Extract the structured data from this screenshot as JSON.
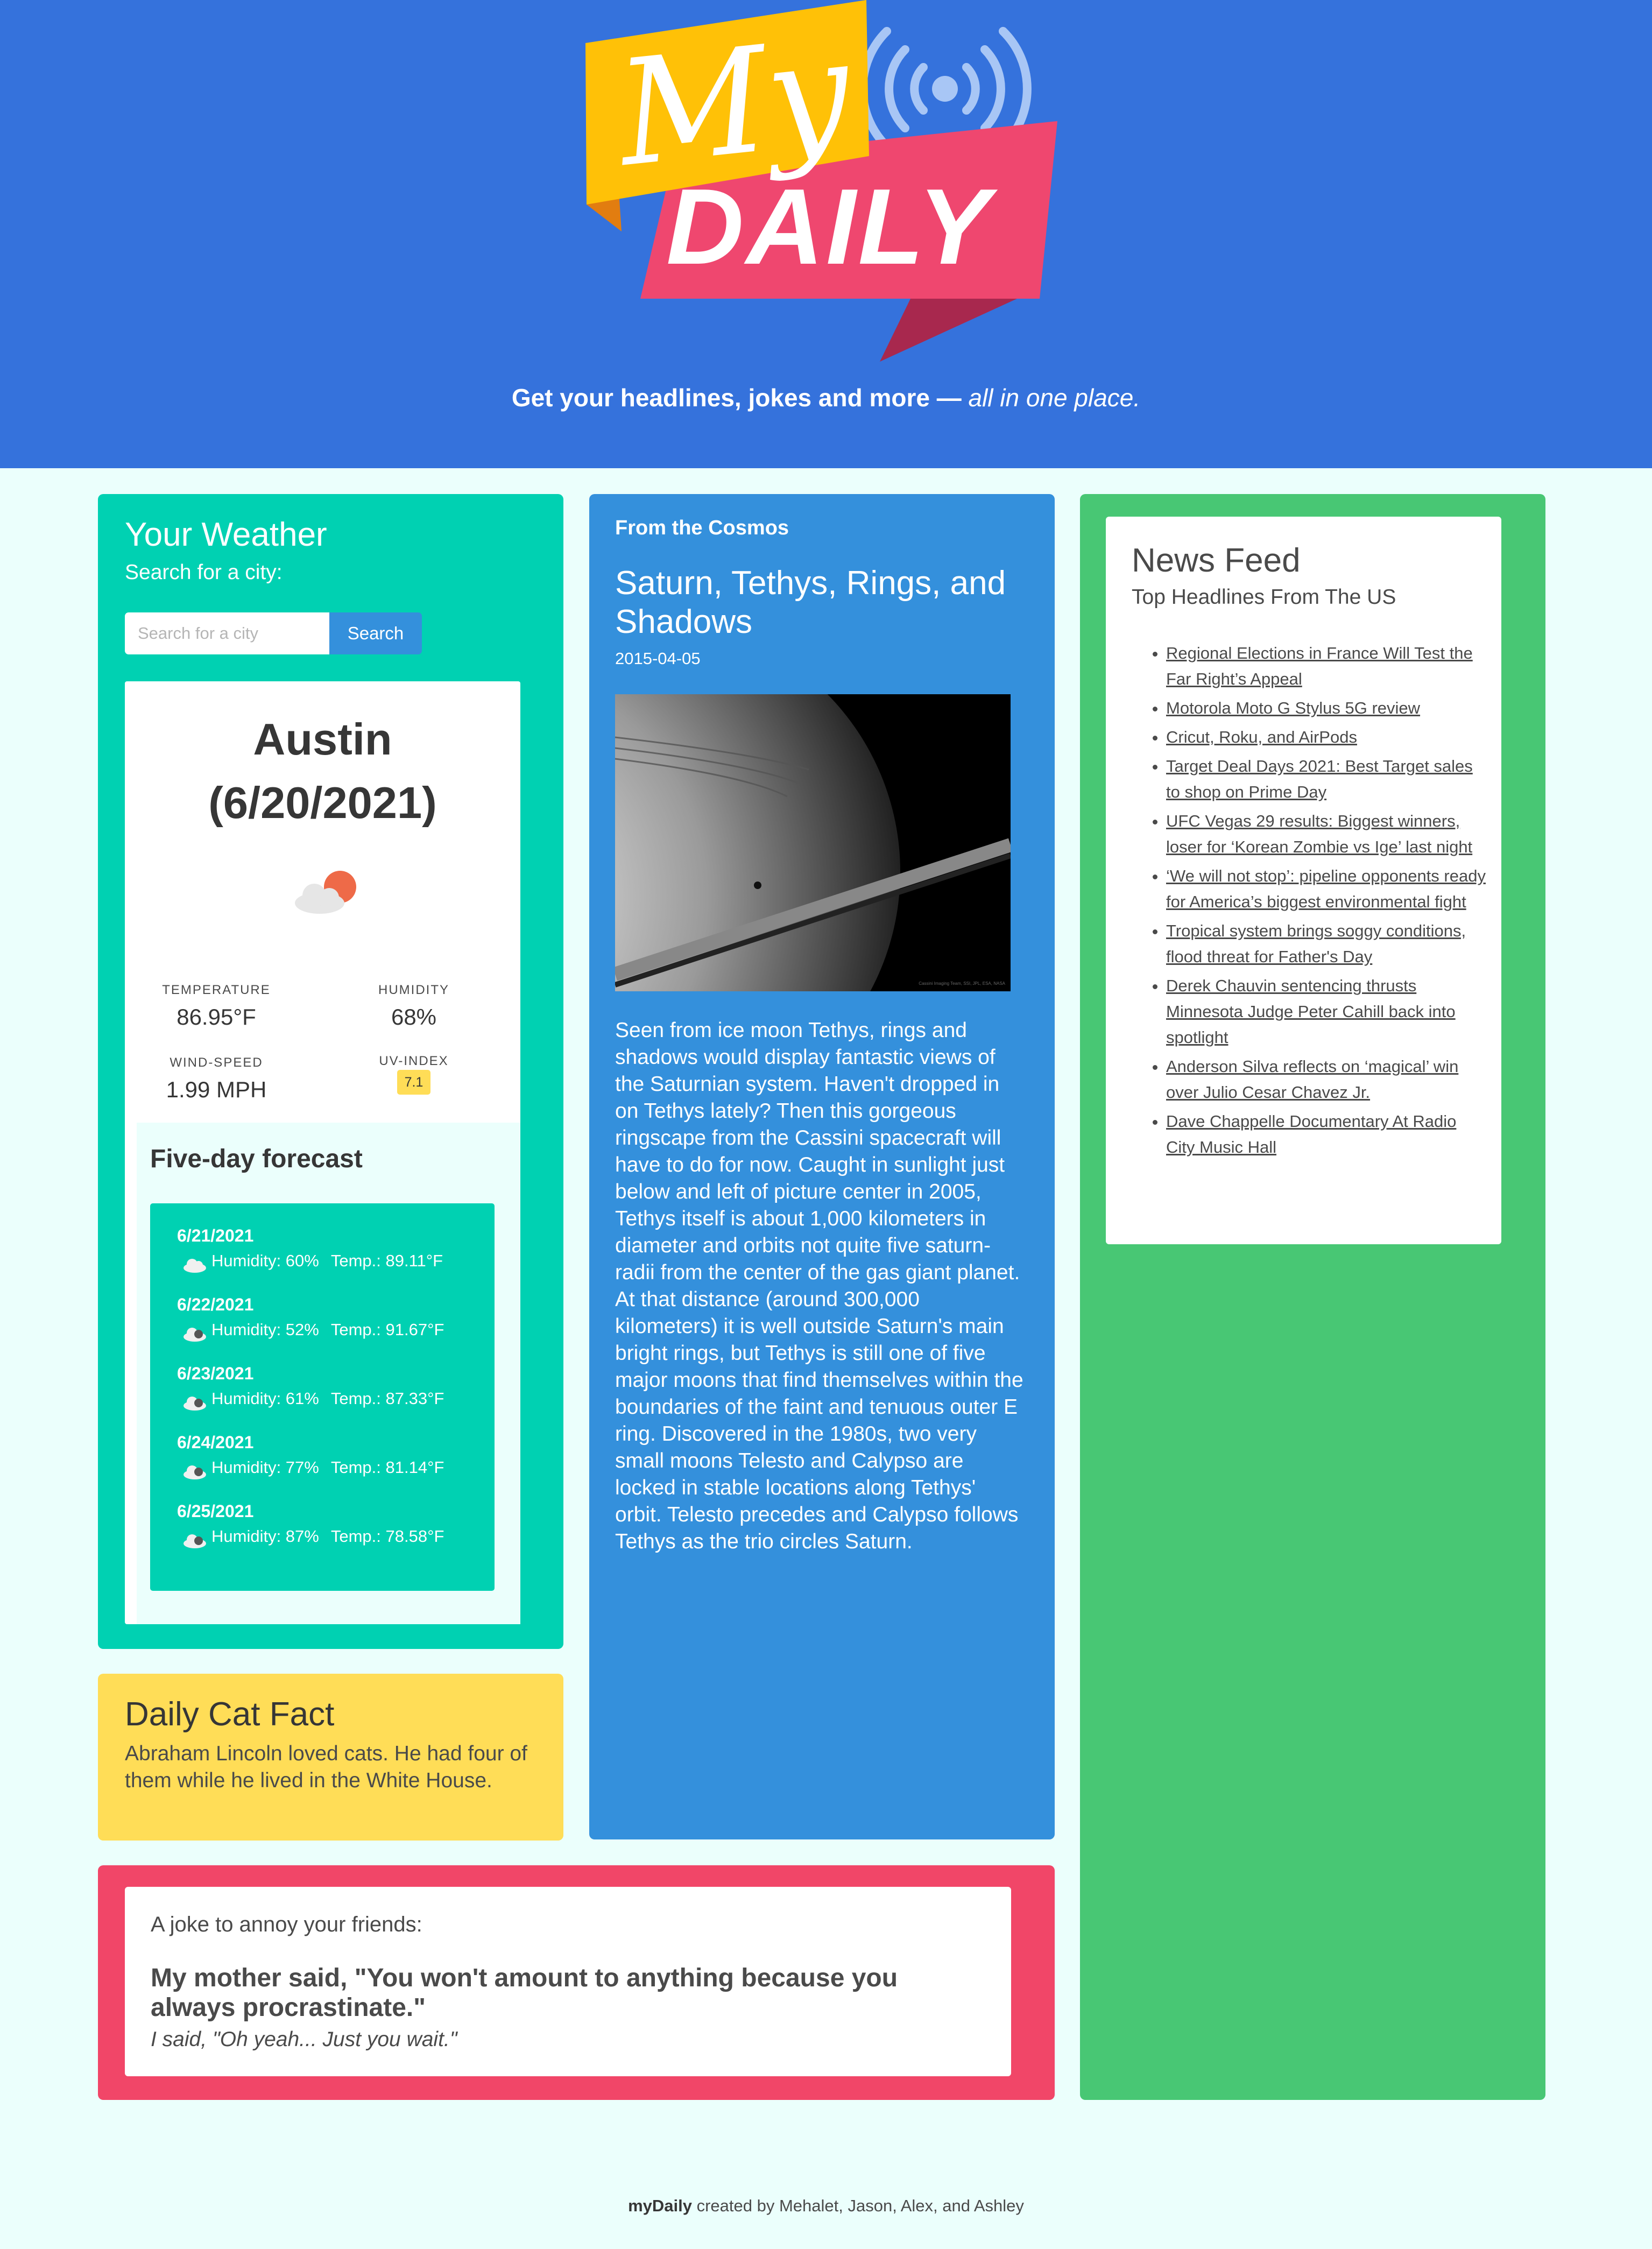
{
  "header": {
    "logo_my": "My",
    "logo_daily": "DAILY",
    "tagline_main": "Get your headlines, jokes and more —",
    "tagline_em": "all in one place."
  },
  "weather": {
    "title": "Your Weather",
    "subtitle": "Search for a city:",
    "search_placeholder": "Search for a city",
    "search_button": "Search",
    "city": "Austin",
    "date": "(6/20/2021)",
    "icon": "cloud-sun-icon",
    "temperature_label": "TEMPERATURE",
    "temperature": "86.95°F",
    "humidity_label": "HUMIDITY",
    "humidity": "68%",
    "wind_label": "WIND-SPEED",
    "wind": "1.99 MPH",
    "uv_label": "UV-INDEX",
    "uv": "7.1",
    "uv_color": "#ffdd57",
    "forecast_title": "Five-day forecast",
    "forecast": [
      {
        "date": "6/21/2021",
        "icon": "cloud-icon",
        "humidity": "Humidity: 60%",
        "temp": "Temp.: 89.11°F"
      },
      {
        "date": "6/22/2021",
        "icon": "rain-cloud-icon",
        "humidity": "Humidity: 52%",
        "temp": "Temp.: 91.67°F"
      },
      {
        "date": "6/23/2021",
        "icon": "rain-cloud-icon",
        "humidity": "Humidity: 61%",
        "temp": "Temp.: 87.33°F"
      },
      {
        "date": "6/24/2021",
        "icon": "rain-cloud-icon",
        "humidity": "Humidity: 77%",
        "temp": "Temp.: 81.14°F"
      },
      {
        "date": "6/25/2021",
        "icon": "rain-cloud-icon",
        "humidity": "Humidity: 87%",
        "temp": "Temp.: 78.58°F"
      }
    ]
  },
  "cat_fact": {
    "title": "Daily Cat Fact",
    "text": "Abraham Lincoln loved cats. He had four of them while he lived in the White House."
  },
  "cosmos": {
    "kicker": "From the Cosmos",
    "title": "Saturn, Tethys, Rings, and Shadows",
    "date": "2015-04-05",
    "image_credit": "Cassini Imaging Team, SSI, JPL, ESA, NASA",
    "text": "Seen from ice moon Tethys, rings and shadows would display fantastic views of the Saturnian system. Haven't dropped in on Tethys lately? Then this gorgeous ringscape from the Cassini spacecraft will have to do for now. Caught in sunlight just below and left of picture center in 2005, Tethys itself is about 1,000 kilometers in diameter and orbits not quite five saturn-radii from the center of the gas giant planet. At that distance (around 300,000 kilometers) it is well outside Saturn's main bright rings, but Tethys is still one of five major moons that find themselves within the boundaries of the faint and tenuous outer E ring. Discovered in the 1980s, two very small moons Telesto and Calypso are locked in stable locations along Tethys' orbit. Telesto precedes and Calypso follows Tethys as the trio circles Saturn."
  },
  "joke": {
    "kicker": "A joke to annoy your friends:",
    "setup": "My mother said, \"You won't amount to anything because you always procrastinate.\"",
    "punchline": "I said, \"Oh yeah... Just you wait.\""
  },
  "news": {
    "title": "News Feed",
    "subtitle": "Top Headlines From The US",
    "headlines": [
      "Regional Elections in France Will Test the Far Right’s Appeal",
      "Motorola Moto G Stylus 5G review",
      "Cricut, Roku, and AirPods",
      "Target Deal Days 2021: Best Target sales to shop on Prime Day",
      "UFC Vegas 29 results: Biggest winners, loser for ‘Korean Zombie vs Ige’ last night",
      "‘We will not stop’: pipeline opponents ready for America’s biggest environmental fight",
      "Tropical system brings soggy conditions, flood threat for Father's Day",
      "Derek Chauvin sentencing thrusts Minnesota Judge Peter Cahill back into spotlight",
      "Anderson Silva reflects on ‘magical’ win over Julio Cesar Chavez Jr.",
      "Dave Chappelle Documentary At Radio City Music Hall"
    ]
  },
  "footer": {
    "brand": "myDaily",
    "credits": "created by Mehalet, Jason, Alex, and Ashley"
  },
  "colors": {
    "header_bg": "#3572dc",
    "page_bg": "#ebfffc",
    "weather_bg": "#00d1b2",
    "cosmos_bg": "#3490dc",
    "news_bg": "#48c774",
    "cat_bg": "#ffdd57",
    "joke_bg": "#f14668",
    "logo_yellow": "#ffc107",
    "logo_pink": "#ef476f"
  }
}
